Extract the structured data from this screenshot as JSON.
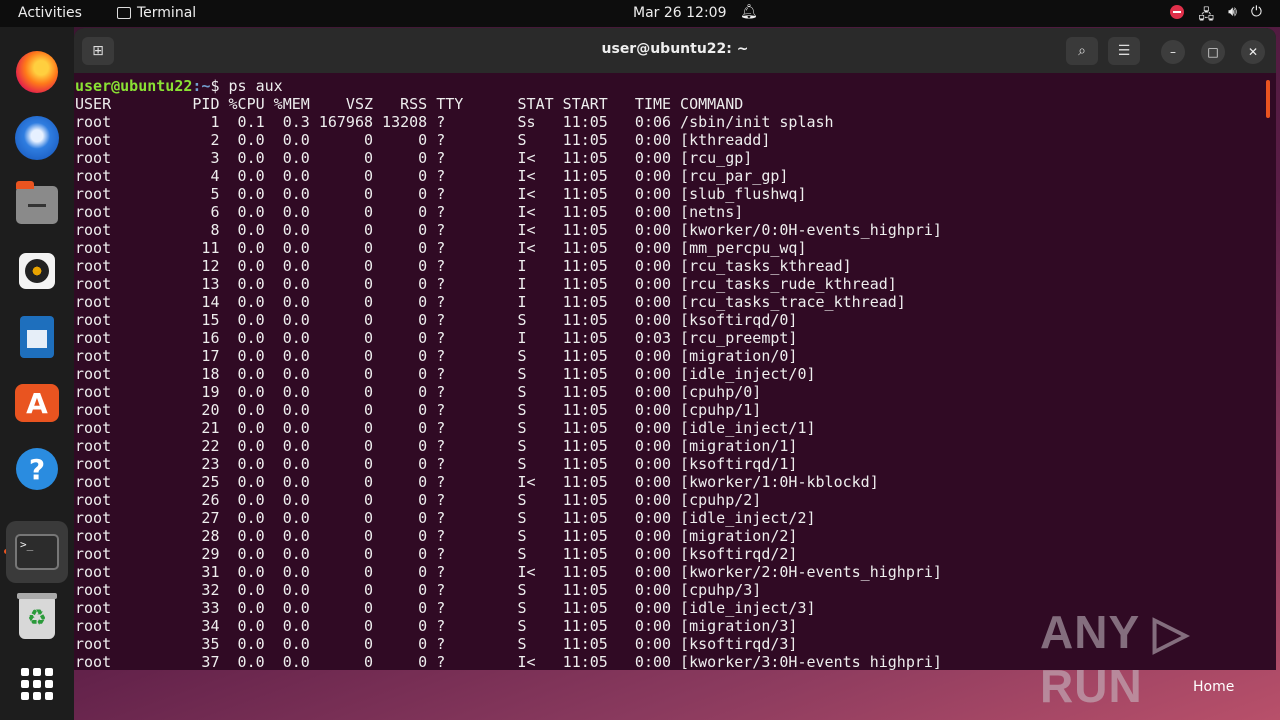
{
  "topbar": {
    "activities": "Activities",
    "app_name": "Terminal",
    "clock": "Mar 26  12:09",
    "icons": [
      "bell-icon",
      "red-status-icon",
      "network-icon",
      "volume-icon",
      "power-icon"
    ]
  },
  "dock": {
    "items": [
      "firefox-icon",
      "thunderbird-icon",
      "files-icon",
      "rhythmbox-icon",
      "libreoffice-writer-icon",
      "app-center-icon",
      "help-icon",
      "terminal-icon",
      "trash-icon",
      "show-apps-icon"
    ]
  },
  "window": {
    "title": "user@ubuntu22: ~"
  },
  "terminal": {
    "prompt_user": "user@ubuntu22",
    "prompt_path": ":~",
    "prompt_symbol": "$ ",
    "command": "ps aux",
    "header": "USER         PID %CPU %MEM    VSZ   RSS TTY      STAT START   TIME COMMAND",
    "rows": [
      "root           1  0.1  0.3 167968 13208 ?        Ss   11:05   0:06 /sbin/init splash",
      "root           2  0.0  0.0      0     0 ?        S    11:05   0:00 [kthreadd]",
      "root           3  0.0  0.0      0     0 ?        I<   11:05   0:00 [rcu_gp]",
      "root           4  0.0  0.0      0     0 ?        I<   11:05   0:00 [rcu_par_gp]",
      "root           5  0.0  0.0      0     0 ?        I<   11:05   0:00 [slub_flushwq]",
      "root           6  0.0  0.0      0     0 ?        I<   11:05   0:00 [netns]",
      "root           8  0.0  0.0      0     0 ?        I<   11:05   0:00 [kworker/0:0H-events_highpri]",
      "root          11  0.0  0.0      0     0 ?        I<   11:05   0:00 [mm_percpu_wq]",
      "root          12  0.0  0.0      0     0 ?        I    11:05   0:00 [rcu_tasks_kthread]",
      "root          13  0.0  0.0      0     0 ?        I    11:05   0:00 [rcu_tasks_rude_kthread]",
      "root          14  0.0  0.0      0     0 ?        I    11:05   0:00 [rcu_tasks_trace_kthread]",
      "root          15  0.0  0.0      0     0 ?        S    11:05   0:00 [ksoftirqd/0]",
      "root          16  0.0  0.0      0     0 ?        I    11:05   0:03 [rcu_preempt]",
      "root          17  0.0  0.0      0     0 ?        S    11:05   0:00 [migration/0]",
      "root          18  0.0  0.0      0     0 ?        S    11:05   0:00 [idle_inject/0]",
      "root          19  0.0  0.0      0     0 ?        S    11:05   0:00 [cpuhp/0]",
      "root          20  0.0  0.0      0     0 ?        S    11:05   0:00 [cpuhp/1]",
      "root          21  0.0  0.0      0     0 ?        S    11:05   0:00 [idle_inject/1]",
      "root          22  0.0  0.0      0     0 ?        S    11:05   0:00 [migration/1]",
      "root          23  0.0  0.0      0     0 ?        S    11:05   0:00 [ksoftirqd/1]",
      "root          25  0.0  0.0      0     0 ?        I<   11:05   0:00 [kworker/1:0H-kblockd]",
      "root          26  0.0  0.0      0     0 ?        S    11:05   0:00 [cpuhp/2]",
      "root          27  0.0  0.0      0     0 ?        S    11:05   0:00 [idle_inject/2]",
      "root          28  0.0  0.0      0     0 ?        S    11:05   0:00 [migration/2]",
      "root          29  0.0  0.0      0     0 ?        S    11:05   0:00 [ksoftirqd/2]",
      "root          31  0.0  0.0      0     0 ?        I<   11:05   0:00 [kworker/2:0H-events_highpri]",
      "root          32  0.0  0.0      0     0 ?        S    11:05   0:00 [cpuhp/3]",
      "root          33  0.0  0.0      0     0 ?        S    11:05   0:00 [idle_inject/3]",
      "root          34  0.0  0.0      0     0 ?        S    11:05   0:00 [migration/3]",
      "root          35  0.0  0.0      0     0 ?        S    11:05   0:00 [ksoftirqd/3]",
      "root          37  0.0  0.0      0     0 ?        I<   11:05   0:00 [kworker/3:0H-events_highpri]"
    ]
  },
  "desktop": {
    "watermark": "ANY ▷ RUN",
    "home_label": "Home"
  },
  "colors": {
    "terminal_bg": "#300a24",
    "accent": "#e95420",
    "prompt_user": "#8ae234",
    "prompt_path": "#729fcf"
  }
}
